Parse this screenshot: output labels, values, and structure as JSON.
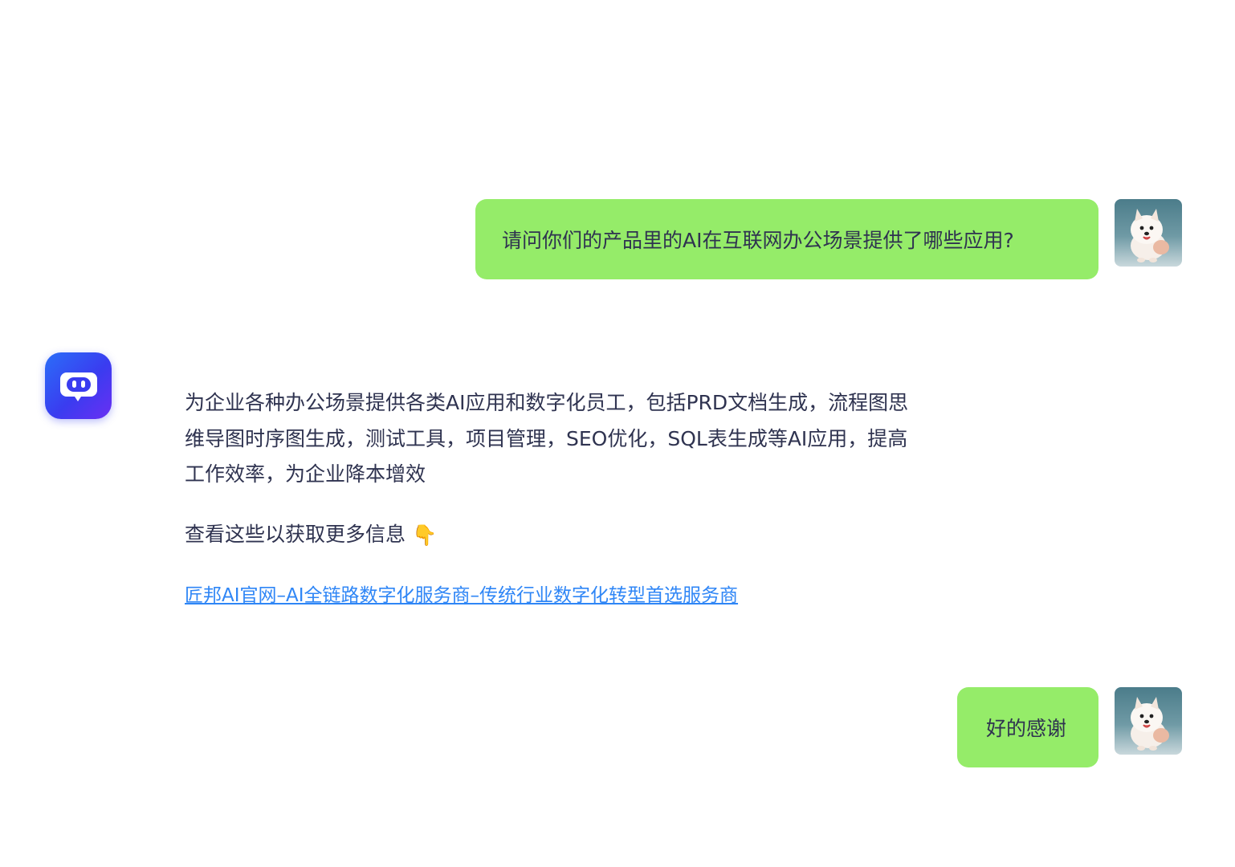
{
  "messages": {
    "user_question": "请问你们的产品里的AI在互联网办公场景提供了哪些应用?",
    "bot_answer_line1": "为企业各种办公场景提供各类AI应用和数字化员工，包括PRD文档生成，流程图思",
    "bot_answer_line2": "维导图时序图生成，测试工具，项目管理，SEO优化，SQL表生成等AI应用，提高",
    "bot_answer_line3": "工作效率，为企业降本增效",
    "bot_hint": "查看这些以获取更多信息",
    "bot_hint_emoji": "👇",
    "bot_link": "匠邦AI官网–AI全链路数字化服务商–传统行业数字化转型首选服务商",
    "user_thanks": "好的感谢"
  },
  "icons": {
    "user_avatar": "samoyed-dog-avatar-icon",
    "bot_avatar": "chat-bot-icon"
  },
  "colors": {
    "user_bubble": "#95ec69",
    "text": "#2f3350",
    "link": "#2f86f6",
    "bot_avatar_gradient_start": "#2b6ef8",
    "bot_avatar_gradient_end": "#6a2ff3"
  }
}
